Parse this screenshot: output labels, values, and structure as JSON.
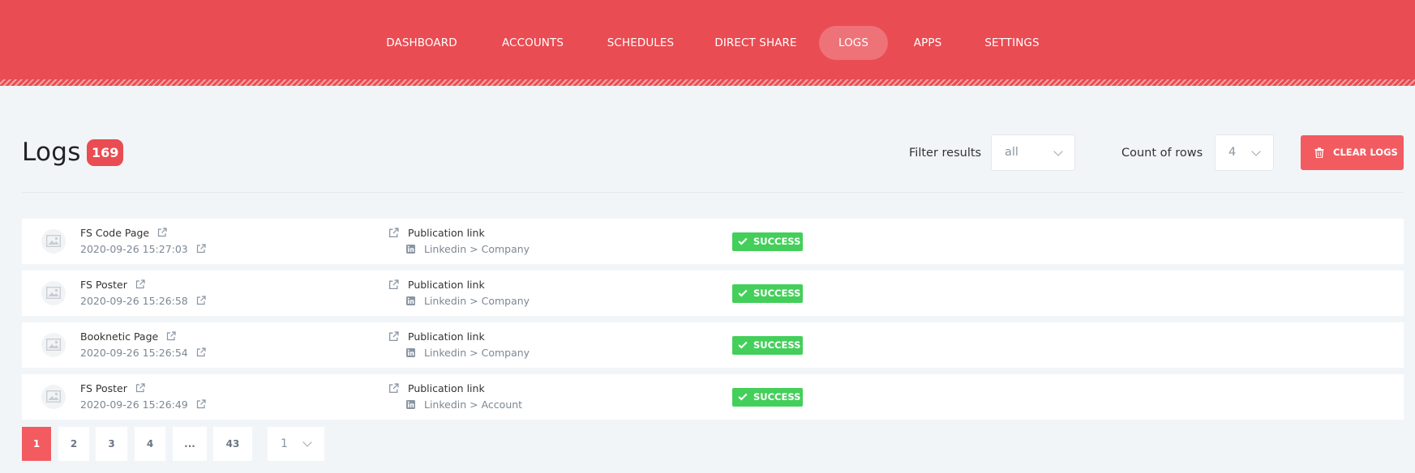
{
  "nav": {
    "items": [
      "DASHBOARD",
      "ACCOUNTS",
      "SCHEDULES",
      "DIRECT SHARE",
      "LOGS",
      "APPS",
      "SETTINGS"
    ],
    "active": "LOGS"
  },
  "header": {
    "title": "Logs",
    "count": "169",
    "filter_label": "Filter results",
    "filter_value": "all",
    "rows_label": "Count of rows",
    "rows_value": "4",
    "clear_button": "CLEAR LOGS"
  },
  "logs": [
    {
      "title": "FS Code Page",
      "date": "2020-09-26 15:27:03",
      "link_label": "Publication link",
      "network": "Linkedin > Company",
      "status": "SUCCESS"
    },
    {
      "title": "FS Poster",
      "date": "2020-09-26 15:26:58",
      "link_label": "Publication link",
      "network": "Linkedin > Company",
      "status": "SUCCESS"
    },
    {
      "title": "Booknetic Page",
      "date": "2020-09-26 15:26:54",
      "link_label": "Publication link",
      "network": "Linkedin > Company",
      "status": "SUCCESS"
    },
    {
      "title": "FS Poster",
      "date": "2020-09-26 15:26:49",
      "link_label": "Publication link",
      "network": "Linkedin > Account",
      "status": "SUCCESS"
    }
  ],
  "pagination": {
    "pages": [
      "1",
      "2",
      "3",
      "4",
      "...",
      "43"
    ],
    "current": "1",
    "select_value": "1"
  },
  "colors": {
    "accent": "#e94c52",
    "button": "#f25b60",
    "success": "#43cf5a",
    "background": "#f2f5f8"
  }
}
